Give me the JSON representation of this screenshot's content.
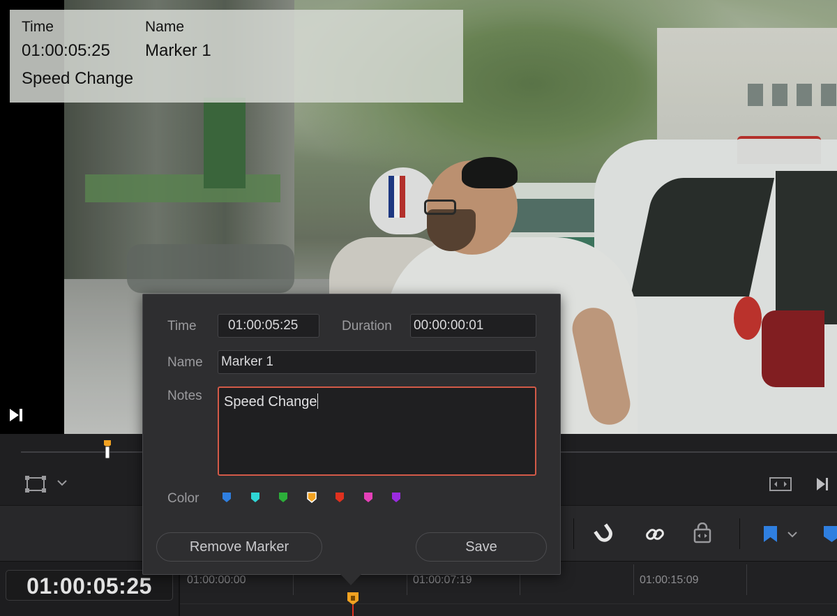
{
  "overlay": {
    "time_label": "Time",
    "time_value": "01:00:05:25",
    "name_label": "Name",
    "name_value": "Marker 1",
    "notes_value": "Speed Change"
  },
  "dialog": {
    "time_label": "Time",
    "time_value": "01:00:05:25",
    "duration_label": "Duration",
    "duration_value": "00:00:00:01",
    "name_label": "Name",
    "name_value": "Marker 1",
    "notes_label": "Notes",
    "notes_value": "Speed Change",
    "color_label": "Color",
    "colors": [
      {
        "name": "blue",
        "hex": "#2f7fe0"
      },
      {
        "name": "cyan",
        "hex": "#2fd6d6"
      },
      {
        "name": "green",
        "hex": "#2cae3a"
      },
      {
        "name": "yellow",
        "hex": "#f2a221",
        "selected": true
      },
      {
        "name": "red",
        "hex": "#e0311f"
      },
      {
        "name": "pink",
        "hex": "#e540b8"
      },
      {
        "name": "purple",
        "hex": "#9a2be0"
      }
    ],
    "remove_label": "Remove Marker",
    "save_label": "Save"
  },
  "timeline": {
    "current_timecode": "01:00:05:25",
    "ruler_labels": [
      "01:00:00:00",
      "01:00:07:19",
      "01:00:15:09"
    ]
  },
  "colors": {
    "accent_marker": "#f2a221",
    "notes_border": "#d35a48",
    "flag_blue": "#2f7fe0"
  }
}
